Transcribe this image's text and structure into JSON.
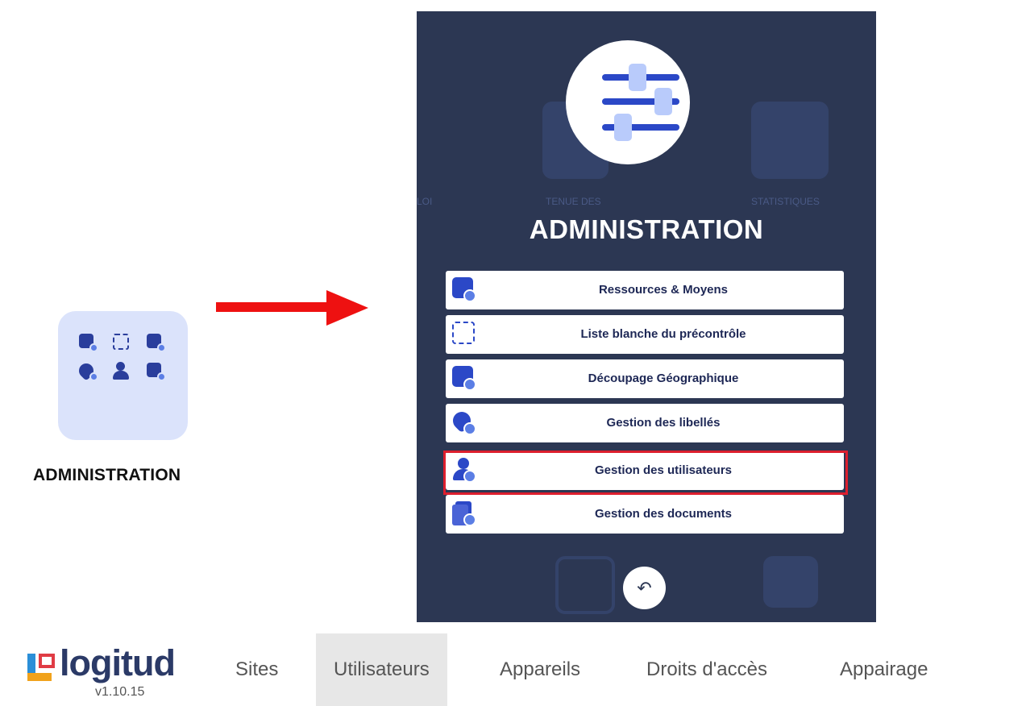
{
  "tile": {
    "label": "ADMINISTRATION",
    "icons": [
      "resources-icon",
      "whitelist-icon",
      "map-icon",
      "tag-icon",
      "user-icon",
      "documents-icon"
    ]
  },
  "panel": {
    "ghost_labels": [
      "LOI",
      "TENUE DES",
      "STATISTIQUES"
    ],
    "title": "ADMINISTRATION",
    "menu": [
      {
        "label": "Ressources & Moyens",
        "icon": "resources-icon"
      },
      {
        "label": "Liste blanche du précontrôle",
        "icon": "whitelist-icon"
      },
      {
        "label": "Découpage Géographique",
        "icon": "map-icon"
      },
      {
        "label": "Gestion des libellés",
        "icon": "tag-icon"
      },
      {
        "label": "Gestion des utilisateurs",
        "icon": "user-icon",
        "highlighted": true
      },
      {
        "label": "Gestion des documents",
        "icon": "documents-icon"
      }
    ],
    "back_glyph": "↶"
  },
  "nav": {
    "logo": "logitud",
    "version": "v1.10.15",
    "tabs": [
      "Sites",
      "Utilisateurs",
      "Appareils",
      "Droits d'accès",
      "Appairage"
    ],
    "active_tab": "Utilisateurs"
  },
  "colors": {
    "panel_bg": "#2c3753",
    "tile_bg": "#dbe3fb",
    "accent": "#2b48c7",
    "arrow": "#ee1111",
    "highlight": "#dd1f2e"
  }
}
